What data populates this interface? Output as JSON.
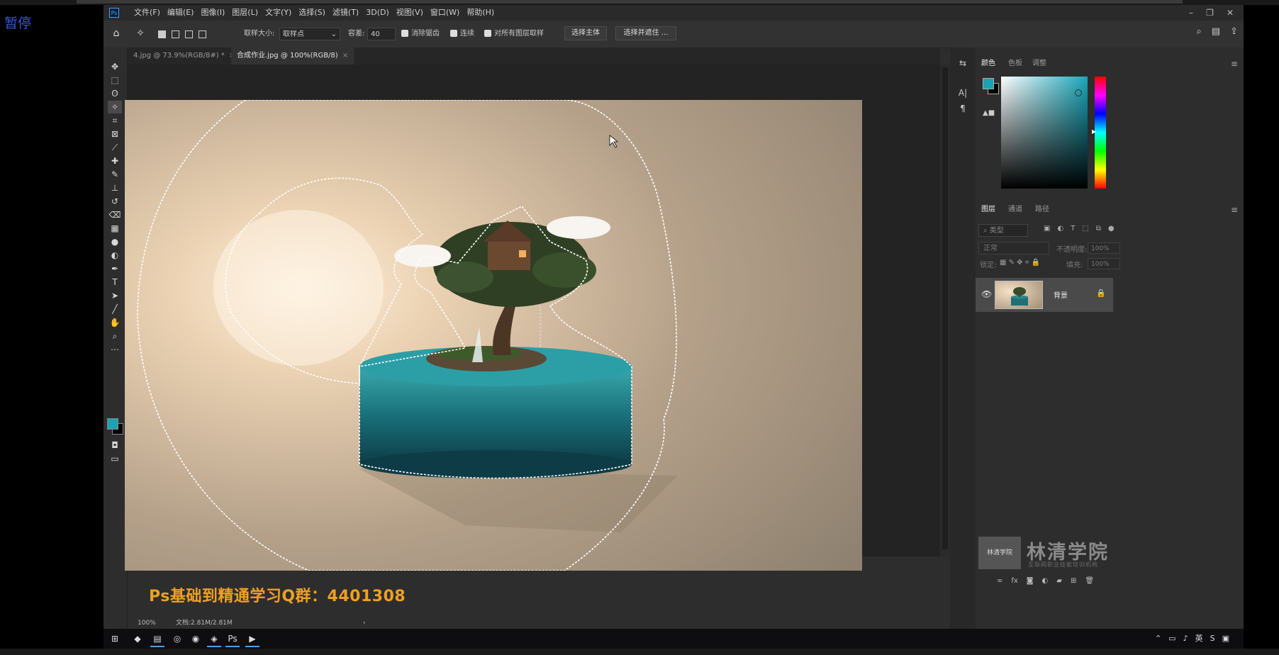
{
  "overlay": {
    "pause_label": "暂停"
  },
  "app": {
    "logo": "Ps"
  },
  "menu": [
    "文件(F)",
    "编辑(E)",
    "图像(I)",
    "图层(L)",
    "文字(Y)",
    "选择(S)",
    "滤镜(T)",
    "3D(D)",
    "视图(V)",
    "窗口(W)",
    "帮助(H)"
  ],
  "options": {
    "sample_size_label": "取样大小:",
    "sample_size_value": "取样点",
    "tolerance_label": "容差:",
    "tolerance_value": "40",
    "antialias_label": "消除锯齿",
    "contiguous_label": "连续",
    "sample_all_label": "对所有图层取样",
    "select_subject_btn": "选择主体",
    "select_mask_btn": "选择并遮住 ..."
  },
  "tabs": [
    {
      "label": "4.jpg @ 73.9%(RGB/8#) *",
      "close": "×"
    },
    {
      "label": "合成作业.jpg @ 100%(RGB/8)",
      "close": "×"
    }
  ],
  "colors": {
    "foreground": "#1ba3b4",
    "background": "#000000"
  },
  "ad": {
    "text": "Ps基础到精通学习Q群：4401308"
  },
  "status": {
    "zoom": "100%",
    "doc": "文档:2.81M/2.81M",
    "arrow": "›"
  },
  "color_panel": {
    "tabs": [
      "颜色",
      "色板",
      "调整"
    ]
  },
  "layers_panel": {
    "tabs": [
      "图层",
      "通道",
      "路径"
    ],
    "search_placeholder": "类型",
    "blend_mode": "正常",
    "opacity_label": "不透明度:",
    "opacity_value": "100%",
    "lock_label": "锁定:",
    "fill_label": "填充:",
    "fill_value": "100%",
    "layers": [
      {
        "name": "背景"
      }
    ]
  },
  "watermark": {
    "logo_text": "林清学院",
    "title": "林清学院",
    "subtitle": "互联网职业技能培训机构"
  },
  "taskbar": {
    "tray_lang": "英"
  }
}
